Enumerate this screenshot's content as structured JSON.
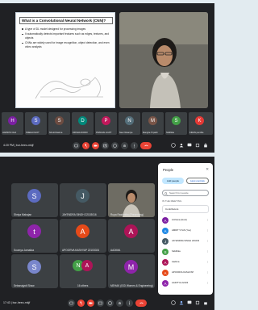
{
  "top_meeting": {
    "slide": {
      "title": "What is a Convolutional Neural Network (CNN)?",
      "bullets": [
        "A type of DL model designed for processing images",
        "It automatically detects important features such as edges, textures, and objects",
        "CNNs are widely used for image recognition, object detection, and even video analysis"
      ]
    },
    "strip": [
      {
        "name": "HARSITA CHA",
        "initial": "H",
        "color": "#7b1fa2"
      },
      {
        "name": "SNEHA KHOT",
        "initial": "S",
        "color": "#5c6bc0"
      },
      {
        "name": "Shruti Rasima",
        "initial": "S",
        "color": "#6d4c41"
      },
      {
        "name": "DIKSHA DODDI",
        "initial": "D",
        "color": "#00897b"
      },
      {
        "name": "PRANJAL GUPT",
        "initial": "P",
        "color": "#c2185b"
      },
      {
        "name": "Neer Nisaniya",
        "initial": "N",
        "color": "#546e7a"
      },
      {
        "name": "Mangha Tripathi",
        "initial": "M",
        "color": "#795548"
      },
      {
        "name": "Siddhika",
        "initial": "S",
        "color": "#43a047"
      },
      {
        "name": "KIRAN pendha",
        "initial": "K",
        "color": "#e53935"
      }
    ],
    "time": "4:20 PM | bur-heeo-mkjf"
  },
  "bottom_meeting": {
    "tiles": [
      {
        "name": "Shriya Mahajan",
        "initial": "S",
        "color": "#5c6bc0"
      },
      {
        "name": "JAYENDRA SINGH 22103016",
        "initial": "J",
        "color": "#455a64"
      },
      {
        "name": "Rupa Rashmika (Presenting)",
        "initial": "",
        "color": ""
      },
      {
        "name": "Soumya Jamalica",
        "initial": "t",
        "color": "#8e24aa"
      },
      {
        "name": "APOORVA KASHYAP 22103024",
        "initial": "A",
        "color": "#e64a19"
      },
      {
        "name": "AADIMA",
        "initial": "A",
        "color": "#ad1457"
      },
      {
        "name": "Sebanajyoti Shaw",
        "initial": "S",
        "color": "#7986cb"
      },
      {
        "name": "16 others",
        "initial": "N",
        "color": "#43a047"
      },
      {
        "name": "MEHAK (IGD Women & Engineering)",
        "initial": "M",
        "color": "#8e24aa"
      }
    ],
    "time": "17:43 | bur-heeo-mkjf",
    "people_panel": {
      "title": "People",
      "close": "✕",
      "add_people": "Add people",
      "host_controls": "Host controls",
      "search_placeholder": "Search for people",
      "section": "IN THE MEETING",
      "contributors_label": "Contributors",
      "people": [
        {
          "name": "Archana (Host)",
          "initial": "A",
          "color": "#7b1fa2"
        },
        {
          "name": "AMRIT VYAS (You)",
          "initial": "A",
          "color": "#1e88e5"
        },
        {
          "name": "JAYENDRA SINGH 22103016",
          "initial": "J",
          "color": "#455a64"
        },
        {
          "name": "Siddhika",
          "initial": "S",
          "color": "#43a047"
        },
        {
          "name": "Aadima",
          "initial": "A",
          "color": "#ad1457"
        },
        {
          "name": "APOORVA KASHYAP",
          "initial": "A",
          "color": "#e64a19"
        },
        {
          "name": "AADITYA 22103",
          "initial": "A",
          "color": "#8e24aa"
        }
      ]
    }
  }
}
